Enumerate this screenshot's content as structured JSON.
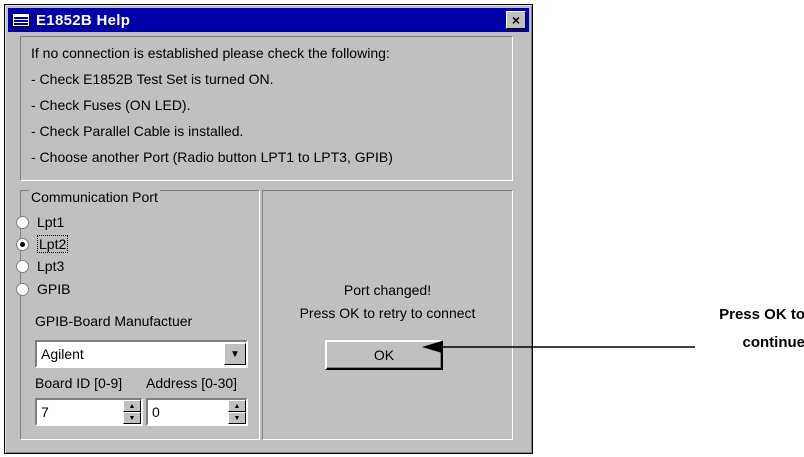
{
  "window": {
    "title": "E1852B Help",
    "close_glyph": "×"
  },
  "info": {
    "lines": [
      "If no connection is established please check the following:",
      "- Check E1852B Test Set is turned ON.",
      "- Check Fuses (ON LED).",
      "- Check Parallel Cable is installed.",
      "- Choose another Port (Radio button LPT1 to LPT3, GPIB)"
    ]
  },
  "port_group": {
    "label": "Communication Port",
    "options": [
      "Lpt1",
      "Lpt2",
      "Lpt3",
      "GPIB"
    ],
    "selected": "Lpt2"
  },
  "gpib": {
    "manufacturer_label": "GPIB-Board Manufactuer",
    "manufacturer_value": "Agilent",
    "board_id_label": "Board ID [0-9]",
    "address_label": "Address [0-30]",
    "board_id_value": "7",
    "address_value": "0"
  },
  "status": {
    "line1": "Port changed!",
    "line2": "Press OK to retry to connect"
  },
  "ok_label": "OK",
  "callout": {
    "line1": "Press OK to",
    "line2": "continue"
  }
}
